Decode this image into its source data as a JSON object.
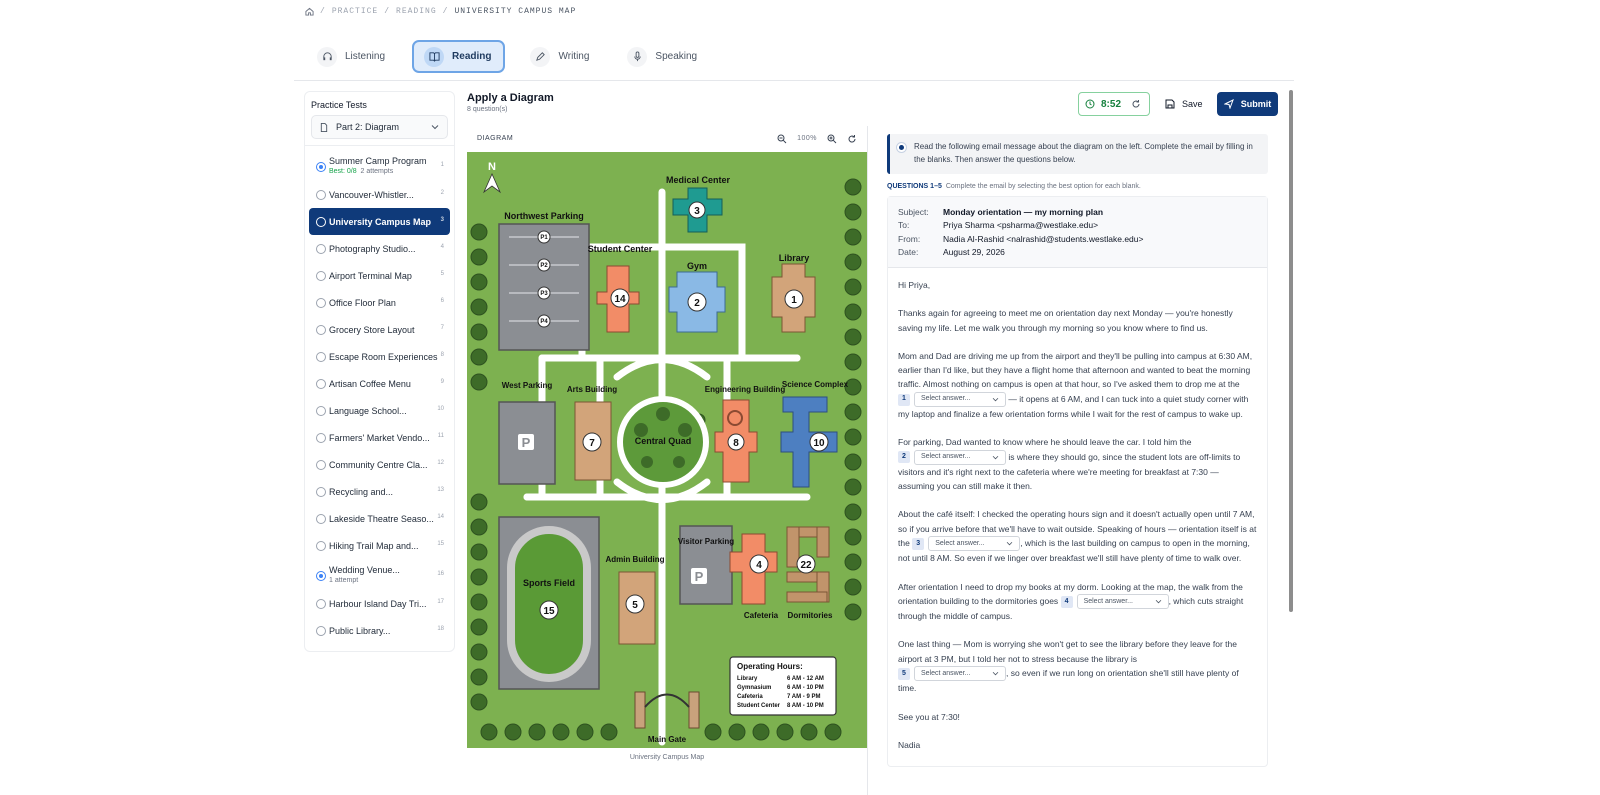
{
  "breadcrumb": {
    "items": [
      "PRACTICE",
      "READING",
      "UNIVERSITY CAMPUS MAP"
    ]
  },
  "tabs": [
    {
      "label": "Listening"
    },
    {
      "label": "Reading"
    },
    {
      "label": "Writing"
    },
    {
      "label": "Speaking"
    }
  ],
  "sidebar": {
    "title": "Practice Tests",
    "dropdown": "Part 2: Diagram",
    "items": [
      {
        "label": "Summer Camp Program",
        "num": "1",
        "best": "Best: 0/8",
        "attempts": "2 attempts"
      },
      {
        "label": "Vancouver-Whistler...",
        "num": "2"
      },
      {
        "label": "University Campus Map",
        "num": "3"
      },
      {
        "label": "Photography Studio...",
        "num": "4"
      },
      {
        "label": "Airport Terminal Map",
        "num": "5"
      },
      {
        "label": "Office Floor Plan",
        "num": "6"
      },
      {
        "label": "Grocery Store Layout",
        "num": "7"
      },
      {
        "label": "Escape Room Experiences",
        "num": "8"
      },
      {
        "label": "Artisan Coffee Menu",
        "num": "9"
      },
      {
        "label": "Language School...",
        "num": "10"
      },
      {
        "label": "Farmers' Market Vendo...",
        "num": "11"
      },
      {
        "label": "Community Centre Cla...",
        "num": "12"
      },
      {
        "label": "Recycling and...",
        "num": "13"
      },
      {
        "label": "Lakeside Theatre Seaso...",
        "num": "14"
      },
      {
        "label": "Hiking Trail Map and...",
        "num": "15"
      },
      {
        "label": "Wedding Venue...",
        "num": "16",
        "attempts": "1 attempt"
      },
      {
        "label": "Harbour Island Day Tri...",
        "num": "17"
      },
      {
        "label": "Public Library...",
        "num": "18"
      }
    ]
  },
  "header": {
    "title": "Apply a Diagram",
    "subtitle": "8 question(s)",
    "timer": "8:52",
    "save": "Save",
    "submit": "Submit"
  },
  "diagram": {
    "label": "DIAGRAM",
    "zoom": "100%",
    "caption": "University Campus Map",
    "compass": "N",
    "buildings": {
      "medical": "Medical Center",
      "nwparking": "Northwest Parking",
      "student": "Student Center",
      "gym": "Gym",
      "library": "Library",
      "westparking": "West Parking",
      "arts": "Arts Building",
      "quad": "Central Quad",
      "engineering": "Engineering Building",
      "science": "Science Complex",
      "admin": "Admin Building",
      "visitor": "Visitor Parking",
      "sports": "Sports Field",
      "cafeteria": "Cafeteria",
      "dorms": "Dormitories",
      "gate": "Main Gate"
    },
    "parking_labels": [
      "P1",
      "P2",
      "P3",
      "P4"
    ],
    "hours": {
      "title": "Operating Hours:",
      "rows": [
        [
          "Library",
          "6 AM - 12 AM"
        ],
        [
          "Gymnasium",
          "6 AM - 10 PM"
        ],
        [
          "Cafeteria",
          "7 AM - 9 PM"
        ],
        [
          "Student Center",
          "8 AM - 10 PM"
        ]
      ]
    }
  },
  "instructions": "Read the following email message about the diagram on the left. Complete the email by filling in the blanks. Then answer the questions below.",
  "questions": {
    "range": "QUESTIONS 1–5",
    "hint": "Complete the email by selecting the best option for each blank.",
    "placeholder": "Select answer..."
  },
  "email": {
    "subject_k": "Subject:",
    "subject": "Monday orientation — my morning plan",
    "to_k": "To:",
    "to": "Priya Sharma <psharma@westlake.edu>",
    "from_k": "From:",
    "from": "Nadia Al-Rashid <nalrashid@students.westlake.edu>",
    "date_k": "Date:",
    "date": "August 29, 2026",
    "greeting": "Hi Priya,",
    "p1": "Thanks again for agreeing to meet me on orientation day next Monday — you're honestly saving my life. Let me walk you through my morning so you know where to find us.",
    "p2a": "Mom and Dad are driving me up from the airport and they'll be pulling into campus at 6:30 AM, earlier than I'd like, but they have a flight home that afternoon and wanted to beat the morning traffic. Almost nothing on campus is open at that hour, so I've asked them to drop me at the",
    "p2b": "— it opens at 6 AM, and I can tuck into a quiet study corner with my laptop and finalize a few orientation forms while I wait for the rest of campus to wake up.",
    "p3a": "For parking, Dad wanted to know where he should leave the car. I told him the",
    "p3b": "is where they should go, since the student lots are off-limits to visitors and it's right next to the cafeteria where we're meeting for breakfast at 7:30 — assuming you can still make it then.",
    "p4a": "About the café itself: I checked the operating hours sign and it doesn't actually open until 7 AM, so if you arrive before that we'll have to wait outside. Speaking of hours — orientation itself is at the",
    "p4b": ", which is the last building on campus to open in the morning, not until 8 AM. So even if we linger over breakfast we'll still have plenty of time to walk over.",
    "p5a": "After orientation I need to drop my books at my dorm. Looking at the map, the walk from the orientation building to the dormitories goes",
    "p5b": ", which cuts straight through the middle of campus.",
    "p6a": "One last thing — Mom is worrying she won't get to see the library before they leave for the airport at 3 PM, but I told her not to stress because the library is",
    "p6b": ", so even if we run long on orientation she'll still have plenty of time.",
    "closing": "See you at 7:30!",
    "signature": "Nadia"
  },
  "colors": {
    "accent": "#0f3a7a",
    "grass": "#79ad4f",
    "timer": "#15803d"
  }
}
